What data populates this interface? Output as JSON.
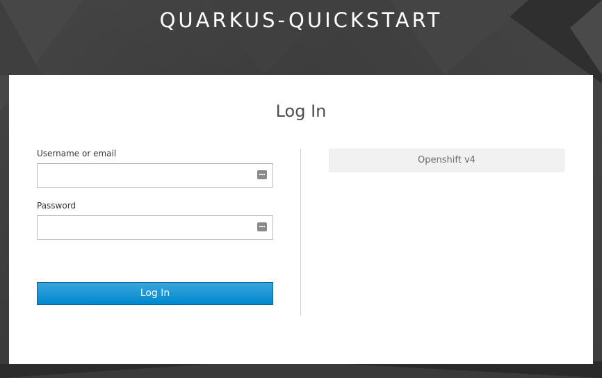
{
  "realm": {
    "title": "QUARKUS-QUICKSTART"
  },
  "login": {
    "title": "Log In",
    "username_label": "Username or email",
    "username_value": "",
    "password_label": "Password",
    "password_value": "",
    "submit_label": "Log In"
  },
  "social": {
    "providers": [
      {
        "label": "Openshift v4"
      }
    ]
  },
  "icons": {
    "password_manager": "password-manager-keys-icon"
  },
  "colors": {
    "background": "#3a3a3a",
    "primary_button": "#0088ce",
    "card": "#ffffff"
  }
}
